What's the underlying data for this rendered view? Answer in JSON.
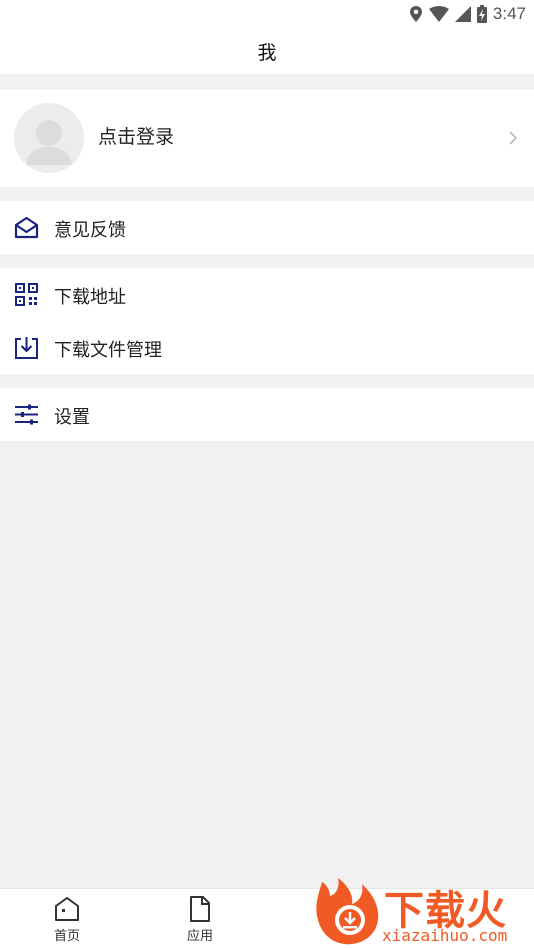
{
  "status_bar": {
    "time": "3:47"
  },
  "header": {
    "title": "我"
  },
  "profile": {
    "login_text": "点击登录"
  },
  "menu": {
    "feedback": "意见反馈",
    "download_address": "下载地址",
    "download_manage": "下载文件管理",
    "settings": "设置"
  },
  "tabs": [
    {
      "label": "首页",
      "icon": "home-icon"
    },
    {
      "label": "应用",
      "icon": "file-icon"
    }
  ],
  "watermark": {
    "brand": "下载火",
    "url": "xiazaihuo.com"
  },
  "colors": {
    "accent": "#1a237e",
    "background": "#f1f1f1",
    "watermark": "#f15a24"
  }
}
